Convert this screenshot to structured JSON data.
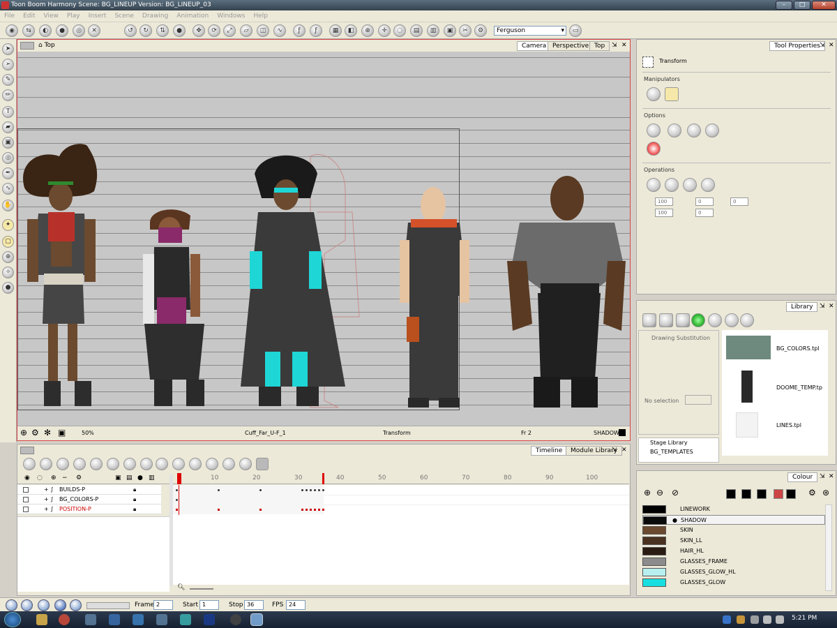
{
  "window": {
    "title": "Toon Boom Harmony Scene: BG_LINEUP Version: BG_LINEUP_03"
  },
  "menu": [
    "File",
    "Edit",
    "View",
    "Play",
    "Insert",
    "Scene",
    "Drawing",
    "Animation",
    "Windows",
    "Help"
  ],
  "toolbar": {
    "character_select": "Ferguson"
  },
  "view": {
    "breadcrumb": "Top",
    "tabs": [
      "Camera",
      "Perspective",
      "Top"
    ],
    "status": {
      "zoom": "50%",
      "drawing": "Cuff_Far_U-F_1",
      "tool": "Transform",
      "frame": "Fr 2",
      "colour": "SHADOW"
    }
  },
  "tool_properties": {
    "tab": "Tool Properties",
    "tool_name": "Transform",
    "manipulators_title": "Manipulators",
    "options_title": "Options",
    "operations_title": "Operations",
    "fields": {
      "width": "100",
      "height": "100",
      "x": "0",
      "y": "0",
      "angle": "0"
    }
  },
  "library": {
    "tab": "Library",
    "drawing_substitution": "Drawing Substitution",
    "no_selection": "No selection",
    "tree": [
      "Stage Library",
      "BG_TEMPLATES"
    ],
    "items": [
      "BG_COLORS.tpl",
      "DOOME_TEMP.tp",
      "LINES.tpl"
    ]
  },
  "colour": {
    "tab": "Colour",
    "swatches": [
      {
        "name": "LINEWORK",
        "color": "#000000"
      },
      {
        "name": "SHADOW",
        "color": "#0a0a0a",
        "selected": true
      },
      {
        "name": "SKIN",
        "color": "#6b4a2f"
      },
      {
        "name": "SKIN_LL",
        "color": "#4a3221"
      },
      {
        "name": "HAIR_HL",
        "color": "#2a1c12"
      },
      {
        "name": "GLASSES_FRAME",
        "color": "#8c8c8c"
      },
      {
        "name": "GLASSES_GLOW_HL",
        "color": "#b8f0f0"
      },
      {
        "name": "GLASSES_GLOW",
        "color": "#19e0e0"
      }
    ]
  },
  "timeline": {
    "tabs": [
      "Timeline",
      "Module Library"
    ],
    "layers": [
      {
        "name": "BUILDS-P",
        "color": "#000000"
      },
      {
        "name": "BG_COLORS-P",
        "color": "#000000"
      },
      {
        "name": "POSITION-P",
        "color": "#cc0000"
      }
    ],
    "ruler": [
      "10",
      "20",
      "30",
      "40",
      "50",
      "60",
      "70",
      "80",
      "90",
      "100"
    ]
  },
  "playback": {
    "frame_label": "Frame",
    "frame": "2",
    "start_label": "Start",
    "start": "1",
    "stop_label": "Stop",
    "stop": "36",
    "fps_label": "FPS",
    "fps": "24"
  },
  "taskbar": {
    "time": "5:21 PM"
  }
}
